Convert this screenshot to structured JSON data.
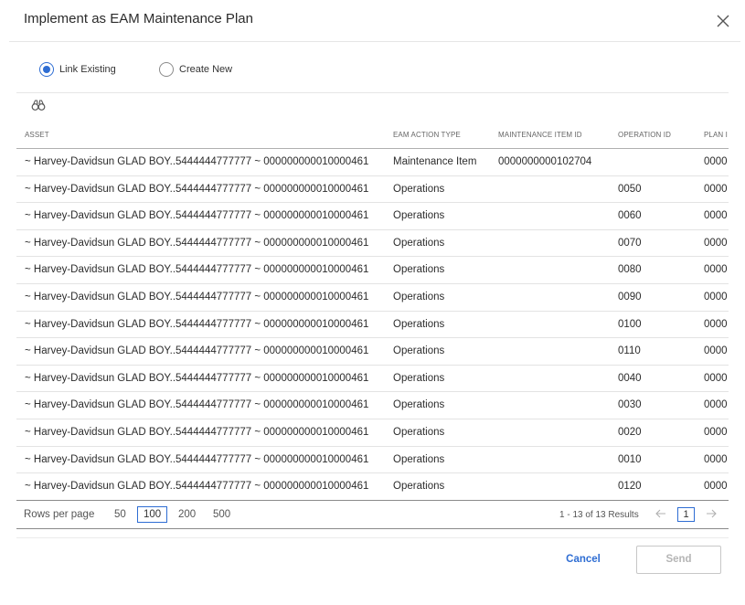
{
  "dialog": {
    "title": "Implement as EAM Maintenance Plan",
    "close_icon": "close-icon"
  },
  "mode": {
    "options": [
      {
        "label": "Link Existing",
        "checked": true
      },
      {
        "label": "Create New",
        "checked": false
      }
    ]
  },
  "toolbar": {
    "search_icon": "binoculars-icon"
  },
  "table": {
    "columns": [
      "ASSET",
      "EAM ACTION TYPE",
      "MAINTENANCE ITEM ID",
      "OPERATION ID",
      "PLAN I"
    ],
    "rows": [
      {
        "asset": "~ Harvey-Davidsun GLAD BOY..5444444777777 ~ 000000000010000461",
        "type": "Maintenance Item",
        "mid": "0000000000102704",
        "op": "",
        "plan": "0000"
      },
      {
        "asset": "~ Harvey-Davidsun GLAD BOY..5444444777777 ~ 000000000010000461",
        "type": "Operations",
        "mid": "",
        "op": "0050",
        "plan": "0000"
      },
      {
        "asset": "~ Harvey-Davidsun GLAD BOY..5444444777777 ~ 000000000010000461",
        "type": "Operations",
        "mid": "",
        "op": "0060",
        "plan": "0000"
      },
      {
        "asset": "~ Harvey-Davidsun GLAD BOY..5444444777777 ~ 000000000010000461",
        "type": "Operations",
        "mid": "",
        "op": "0070",
        "plan": "0000"
      },
      {
        "asset": "~ Harvey-Davidsun GLAD BOY..5444444777777 ~ 000000000010000461",
        "type": "Operations",
        "mid": "",
        "op": "0080",
        "plan": "0000"
      },
      {
        "asset": "~ Harvey-Davidsun GLAD BOY..5444444777777 ~ 000000000010000461",
        "type": "Operations",
        "mid": "",
        "op": "0090",
        "plan": "0000"
      },
      {
        "asset": "~ Harvey-Davidsun GLAD BOY..5444444777777 ~ 000000000010000461",
        "type": "Operations",
        "mid": "",
        "op": "0100",
        "plan": "0000"
      },
      {
        "asset": "~ Harvey-Davidsun GLAD BOY..5444444777777 ~ 000000000010000461",
        "type": "Operations",
        "mid": "",
        "op": "0110",
        "plan": "0000"
      },
      {
        "asset": "~ Harvey-Davidsun GLAD BOY..5444444777777 ~ 000000000010000461",
        "type": "Operations",
        "mid": "",
        "op": "0040",
        "plan": "0000"
      },
      {
        "asset": "~ Harvey-Davidsun GLAD BOY..5444444777777 ~ 000000000010000461",
        "type": "Operations",
        "mid": "",
        "op": "0030",
        "plan": "0000"
      },
      {
        "asset": "~ Harvey-Davidsun GLAD BOY..5444444777777 ~ 000000000010000461",
        "type": "Operations",
        "mid": "",
        "op": "0020",
        "plan": "0000"
      },
      {
        "asset": "~ Harvey-Davidsun GLAD BOY..5444444777777 ~ 000000000010000461",
        "type": "Operations",
        "mid": "",
        "op": "0010",
        "plan": "0000"
      },
      {
        "asset": "~ Harvey-Davidsun GLAD BOY..5444444777777 ~ 000000000010000461",
        "type": "Operations",
        "mid": "",
        "op": "0120",
        "plan": "0000"
      }
    ]
  },
  "pager": {
    "rows_per_page_label": "Rows per page",
    "sizes": [
      "50",
      "100",
      "200",
      "500"
    ],
    "selected_size": "100",
    "results": "1 - 13 of 13 Results",
    "current_page": "1",
    "prev_icon": "arrow-left-icon",
    "next_icon": "arrow-right-icon"
  },
  "footer": {
    "cancel_label": "Cancel",
    "send_label": "Send"
  },
  "colors": {
    "accent": "#2e6dd3",
    "disabled": "#b5b5b5"
  }
}
